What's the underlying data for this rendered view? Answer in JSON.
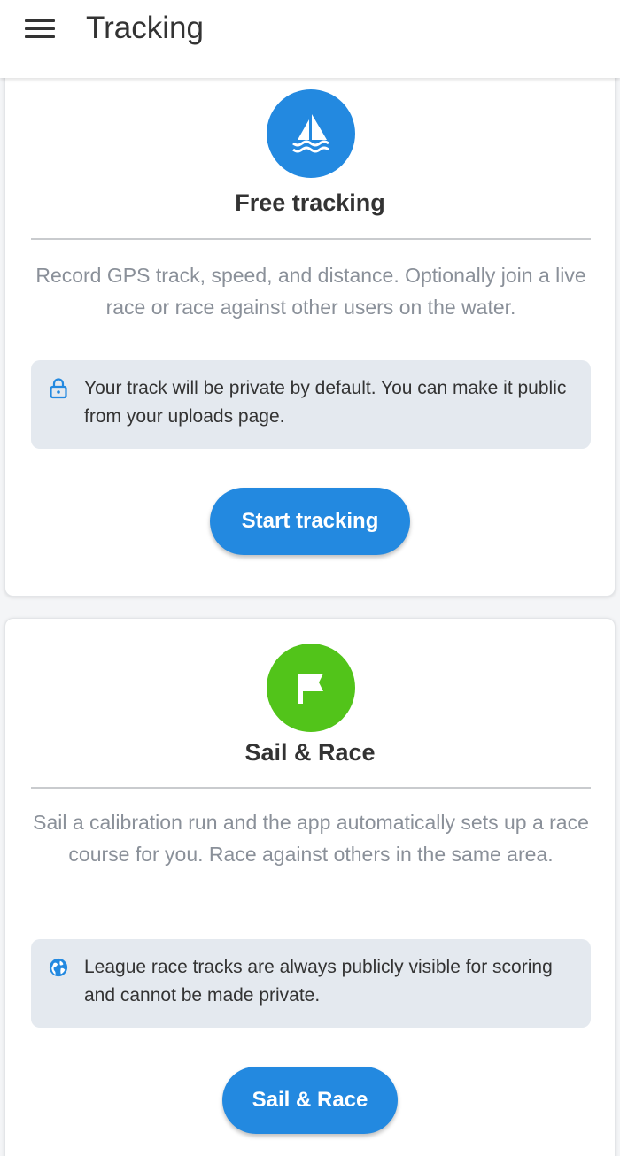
{
  "appbar": {
    "title": "Tracking",
    "menu_icon": "hamburger-menu-icon"
  },
  "cards": [
    {
      "icon": "sailboat-icon",
      "icon_color": "#2389e0",
      "title": "Free tracking",
      "description": "Record GPS track, speed, and distance. Optionally join a live race or race against other users on the water.",
      "notice_icon": "lock-icon",
      "notice": "Your track will be private by default. You can make it public from your uploads page.",
      "button_label": "Start tracking"
    },
    {
      "icon": "flag-icon",
      "icon_color": "#52c41a",
      "title": "Sail & Race",
      "description": "Sail a calibration run and the app automatically sets up a race course for you. Race against others in the same area.",
      "notice_icon": "globe-icon",
      "notice": "League race tracks are always publicly visible for scoring and cannot be made private.",
      "button_label": "Sail & Race"
    }
  ],
  "colors": {
    "primary": "#2389e0",
    "accent_green": "#52c41a",
    "notice_bg": "#e4e9ef",
    "muted_text": "#8a9099"
  }
}
